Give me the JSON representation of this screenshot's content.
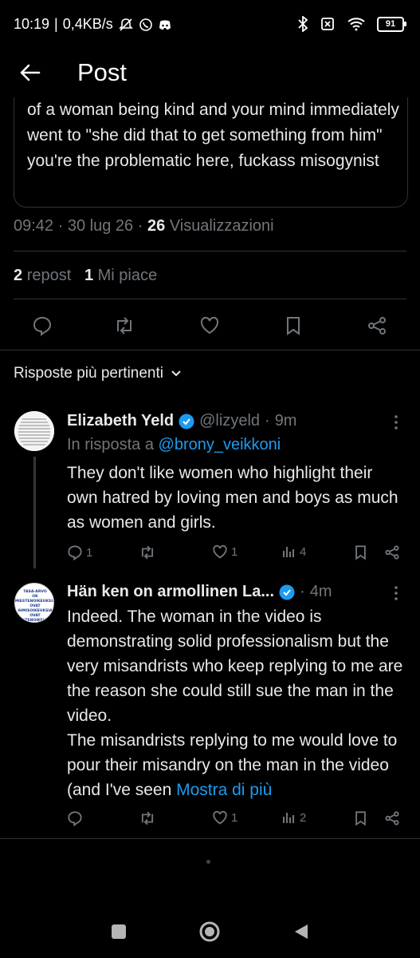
{
  "status_bar": {
    "time": "10:19",
    "net_speed": "0,4KB/s",
    "battery": "91"
  },
  "header": {
    "title": "Post",
    "back_icon": "arrow-left-icon"
  },
  "post": {
    "quoted_text": "of a woman being kind and your mind immediately went to \"she did that to get something from him\" you're the problematic here, fuckass misogynist",
    "time": "09:42",
    "date": "30 lug 26",
    "views_count": "26",
    "views_label": "Visualizzazioni",
    "reposts_count": "2",
    "reposts_label": "repost",
    "likes_count": "1",
    "likes_label": "Mi piace",
    "separator": "·"
  },
  "replies_sort": {
    "label": "Risposte più pertinenti"
  },
  "replies": [
    {
      "name": "Elizabeth Yeld",
      "handle": "@lizyeld",
      "time": "9m",
      "in_reply_prefix": "In risposta a",
      "in_reply_handle": "@brony_veikkoni",
      "text": "They don't like women who highlight their own hatred by loving men and boys as much as women and girls.",
      "replies": "1",
      "reposts": "",
      "likes": "1",
      "views": "4"
    },
    {
      "name": "Hän ken on armollinen La...",
      "handle": "",
      "time": "4m",
      "avatar_text": "TASA-ARVO OK MIESTENOIKEUKSIA OVAT IHMISOIKEUKSIA OVAT MIESTENOIKEUKSIA",
      "text": "Indeed. The woman in the video is demonstrating solid professionalism but the very misandrists who keep replying to me are the reason she could still sue the man in the video.\nThe misandrists replying to me would love to pour their misandry on the man in the video (and I've seen ",
      "show_more": "Mostra di più",
      "replies": "",
      "reposts": "",
      "likes": "1",
      "views": "2"
    }
  ],
  "colors": {
    "background": "#000000",
    "text": "#e7e9ea",
    "muted": "#71767b",
    "link": "#1d9bf0",
    "verified": "#1d9bf0",
    "divider": "#2f3336"
  }
}
